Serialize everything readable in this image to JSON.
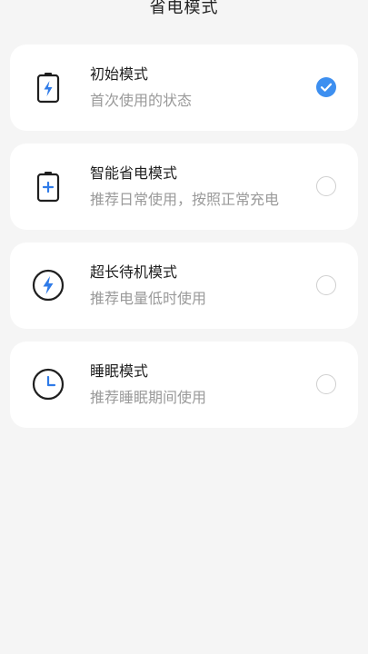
{
  "header": {
    "title": "省电模式"
  },
  "colors": {
    "accent": "#3d8ff0",
    "icon_blue": "#2f7be8"
  },
  "modes": [
    {
      "title": "初始模式",
      "subtitle": "首次使用的状态",
      "icon": "battery-bolt-icon",
      "selected": true
    },
    {
      "title": "智能省电模式",
      "subtitle": "推荐日常使用，按照正常充电",
      "icon": "battery-plus-icon",
      "selected": false
    },
    {
      "title": "超长待机模式",
      "subtitle": "推荐电量低时使用",
      "icon": "bolt-circle-icon",
      "selected": false
    },
    {
      "title": "睡眠模式",
      "subtitle": "推荐睡眠期间使用",
      "icon": "clock-icon",
      "selected": false
    }
  ]
}
